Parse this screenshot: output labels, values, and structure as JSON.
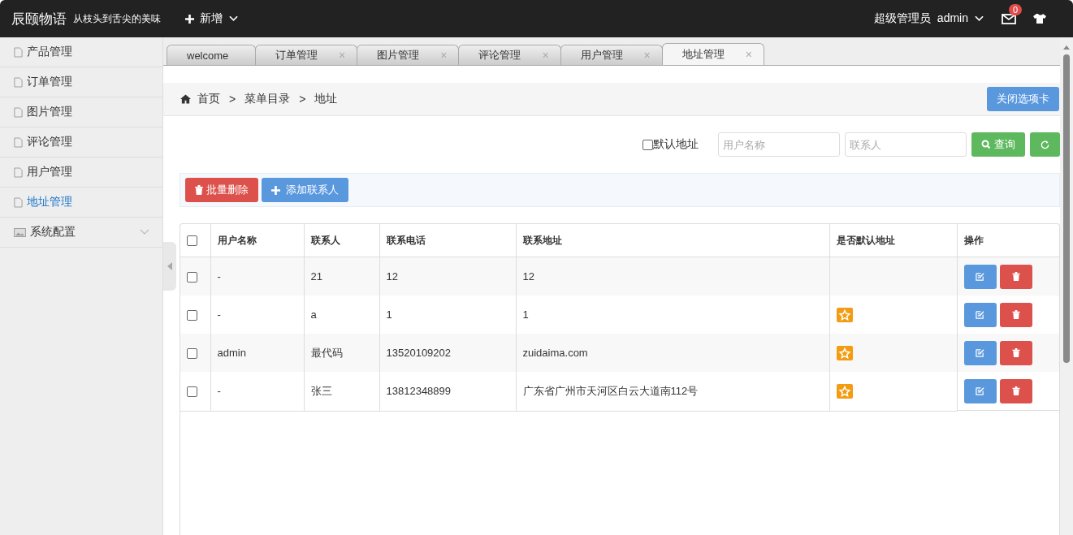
{
  "header": {
    "brand": "辰颐物语",
    "slogan": "从枝头到舌尖的美味",
    "new_menu": "新增",
    "role": "超级管理员",
    "user": "admin",
    "mail_count": "0"
  },
  "sidebar": {
    "items": [
      {
        "label": "产品管理",
        "kind": "page",
        "selected": false
      },
      {
        "label": "订单管理",
        "kind": "page",
        "selected": false
      },
      {
        "label": "图片管理",
        "kind": "page",
        "selected": false
      },
      {
        "label": "评论管理",
        "kind": "page",
        "selected": false
      },
      {
        "label": "用户管理",
        "kind": "page",
        "selected": false
      },
      {
        "label": "地址管理",
        "kind": "page",
        "selected": true
      },
      {
        "label": "系统配置",
        "kind": "group",
        "selected": false
      }
    ]
  },
  "tabs": [
    {
      "label": "welcome",
      "closable": false,
      "selected": false
    },
    {
      "label": "订单管理",
      "closable": true,
      "selected": false
    },
    {
      "label": "图片管理",
      "closable": true,
      "selected": false
    },
    {
      "label": "评论管理",
      "closable": true,
      "selected": false
    },
    {
      "label": "用户管理",
      "closable": true,
      "selected": false
    },
    {
      "label": "地址管理",
      "closable": true,
      "selected": true
    }
  ],
  "tab_close_glyph": "×",
  "breadcrumb": {
    "items": [
      "首页",
      "菜单目录",
      "地址"
    ],
    "separator": ">"
  },
  "close_tab_button": "关闭选项卡",
  "filters": {
    "default_only": {
      "label": "默认地址",
      "checked": false
    },
    "username": {
      "placeholder": "用户名称"
    },
    "contact": {
      "placeholder": "联系人"
    },
    "search_button": "查询"
  },
  "toolbar": {
    "delete_button": "批量删除",
    "add_button": "添加联系人"
  },
  "table": {
    "all_checked": false,
    "columns": [
      "用户名称",
      "联系人",
      "联系电话",
      "联系地址",
      "是否默认地址",
      "操作"
    ],
    "rows": [
      {
        "checked": false,
        "username": "-",
        "contact": "21",
        "phone": "12",
        "address": "12",
        "is_default": false
      },
      {
        "checked": false,
        "username": "-",
        "contact": "a",
        "phone": "1",
        "address": "1",
        "is_default": true
      },
      {
        "checked": false,
        "username": "admin",
        "contact": "最代码",
        "phone": "13520109202",
        "address": "zuidaima.com",
        "is_default": true
      },
      {
        "checked": false,
        "username": "-",
        "contact": "张三",
        "phone": "13812348899",
        "address": "广东省广州市天河区白云大道南112号",
        "is_default": true
      }
    ]
  }
}
